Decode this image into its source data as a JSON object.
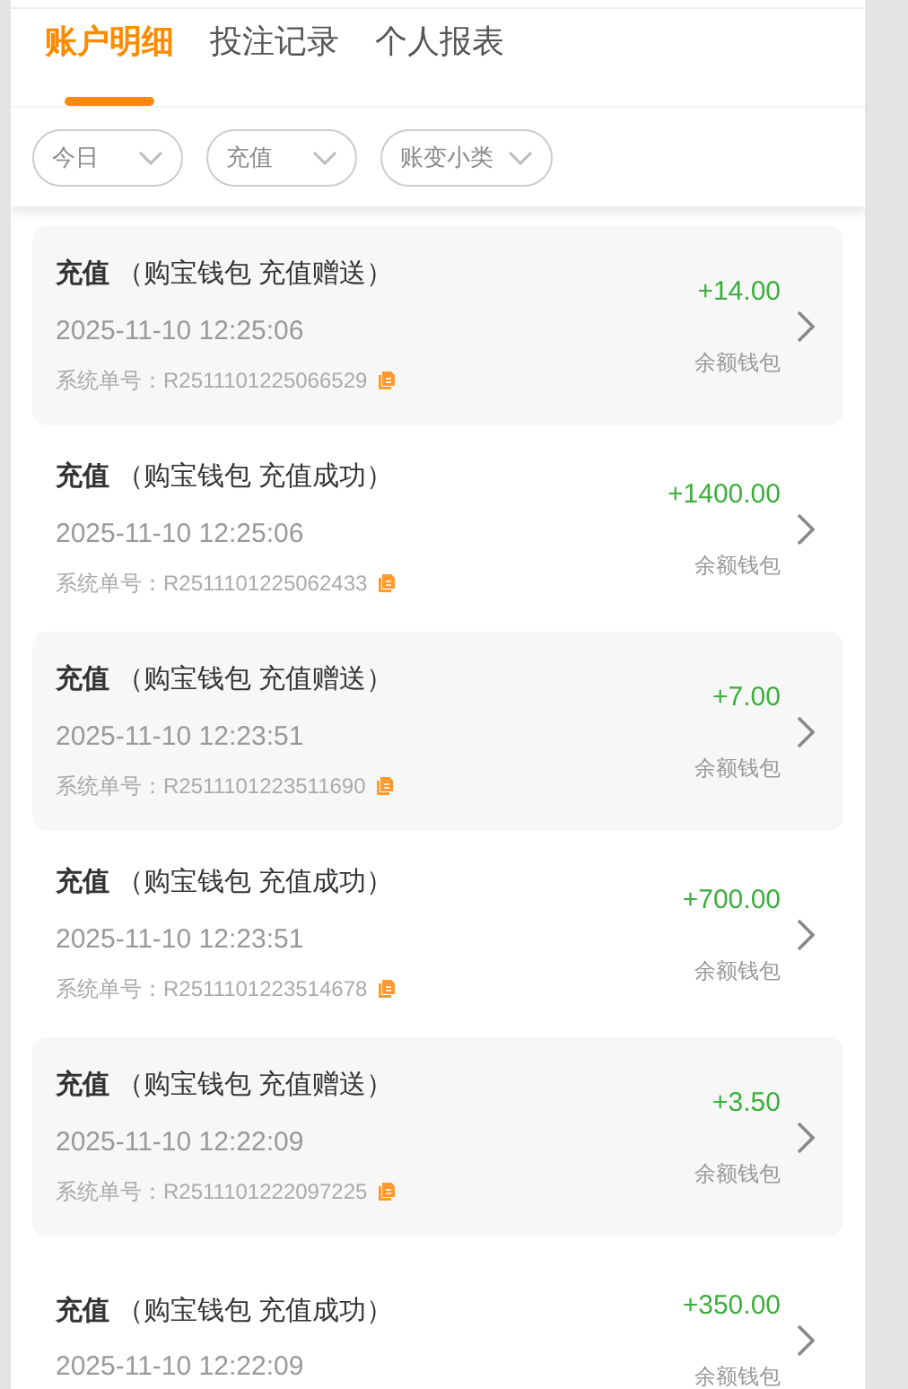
{
  "tabs": [
    {
      "label": "账户明细",
      "selected": true
    },
    {
      "label": "投注记录",
      "selected": false
    },
    {
      "label": "个人报表",
      "selected": false
    }
  ],
  "filters": [
    {
      "label": "今日"
    },
    {
      "label": "充值"
    },
    {
      "label": "账变小类"
    }
  ],
  "records": [
    {
      "type": "充值",
      "detail": "（购宝钱包 充值赠送）",
      "time": "2025-11-10 12:25:06",
      "order_label": "系统单号：",
      "order_no": "R2511101225066529",
      "amount": "+14.00",
      "wallet": "余额钱包"
    },
    {
      "type": "充值",
      "detail": "（购宝钱包 充值成功）",
      "time": "2025-11-10 12:25:06",
      "order_label": "系统单号：",
      "order_no": "R2511101225062433",
      "amount": "+1400.00",
      "wallet": "余额钱包"
    },
    {
      "type": "充值",
      "detail": "（购宝钱包 充值赠送）",
      "time": "2025-11-10 12:23:51",
      "order_label": "系统单号：",
      "order_no": "R2511101223511690",
      "amount": "+7.00",
      "wallet": "余额钱包"
    },
    {
      "type": "充值",
      "detail": "（购宝钱包 充值成功）",
      "time": "2025-11-10 12:23:51",
      "order_label": "系统单号：",
      "order_no": "R2511101223514678",
      "amount": "+700.00",
      "wallet": "余额钱包"
    },
    {
      "type": "充值",
      "detail": "（购宝钱包 充值赠送）",
      "time": "2025-11-10 12:22:09",
      "order_label": "系统单号：",
      "order_no": "R2511101222097225",
      "amount": "+3.50",
      "wallet": "余额钱包"
    },
    {
      "type": "充值",
      "detail": "（购宝钱包 充值成功）",
      "time": "2025-11-10 12:22:09",
      "amount": "+350.00",
      "wallet": "余额钱包"
    }
  ]
}
